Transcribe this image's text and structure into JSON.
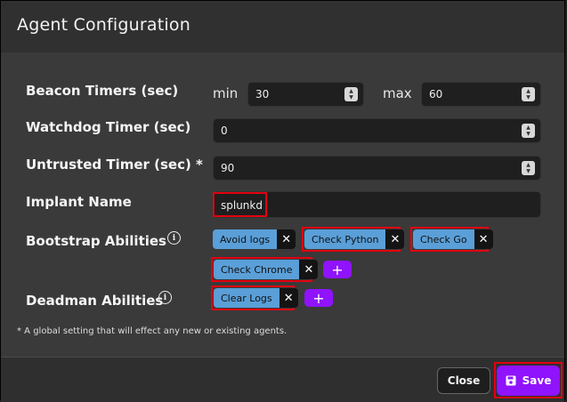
{
  "modal": {
    "title": "Agent Configuration"
  },
  "fields": {
    "beacon": {
      "label": "Beacon Timers (sec)",
      "min_label": "min",
      "min_value": "30",
      "max_label": "max",
      "max_value": "60"
    },
    "watchdog": {
      "label": "Watchdog Timer (sec)",
      "value": "0"
    },
    "untrusted": {
      "label": "Untrusted Timer (sec) *",
      "value": "90"
    },
    "implant": {
      "label": "Implant Name",
      "value": "splunkd"
    },
    "bootstrap": {
      "label": "Bootstrap Abilities",
      "chips": [
        "Avoid logs",
        "Check Python",
        "Check Go",
        "Check Chrome"
      ]
    },
    "deadman": {
      "label": "Deadman Abilities",
      "chips": [
        "Clear Logs"
      ]
    }
  },
  "glyphs": {
    "remove": "✕",
    "add": "+",
    "info": "i",
    "spin_up": "▲",
    "spin_down": "▼"
  },
  "note": "* A global setting that will effect any new or existing agents.",
  "footer": {
    "close_label": "Close",
    "save_label": "Save"
  },
  "colors": {
    "accent": "#9013fe",
    "chip": "#5a9fd8",
    "highlight": "#e3000f"
  },
  "icons": {
    "save": "floppy-disk-icon",
    "info": "info-icon",
    "remove": "close-icon"
  }
}
